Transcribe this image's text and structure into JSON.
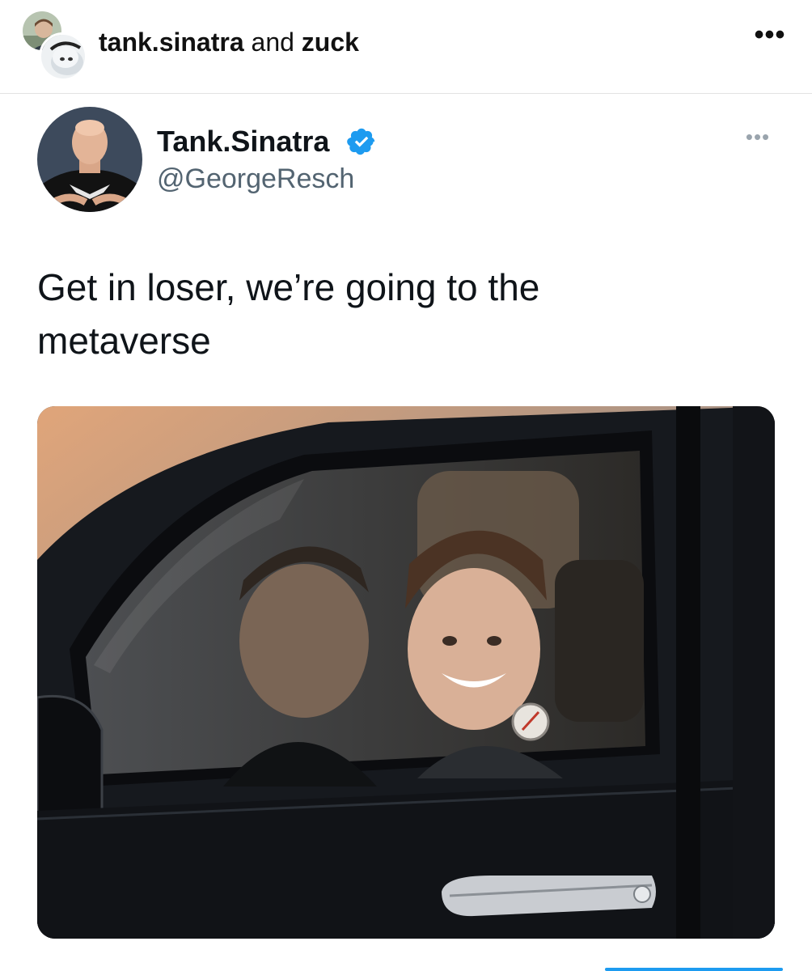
{
  "post_header": {
    "user_one": "tank.sinatra",
    "connector": "and",
    "user_two": "zuck",
    "more_label": "•••"
  },
  "tweet": {
    "display_name": "Tank.Sinatra",
    "handle": "@GeorgeResch",
    "verified": true,
    "more_label": "•••",
    "text_line1": "Get in loser, we’re going to the",
    "text_line2": "metaverse"
  },
  "icons": {
    "verified_badge": "verified-badge-icon",
    "more": "more-options-icon"
  },
  "colors": {
    "verified_blue": "#1d9bf0",
    "handle_gray": "#536471",
    "accent": "#1d9bf0"
  }
}
